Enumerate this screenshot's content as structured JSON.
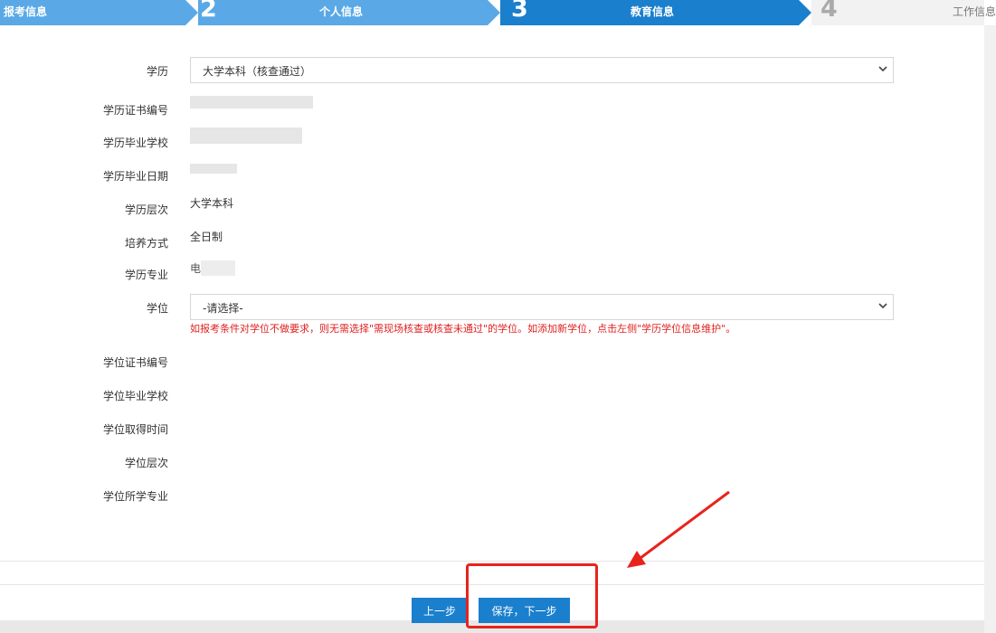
{
  "steps": [
    {
      "num": "",
      "label": "报考信息",
      "active": true
    },
    {
      "num": "2",
      "label": "个人信息",
      "active": true
    },
    {
      "num": "3",
      "label": "教育信息",
      "active": true,
      "current": true
    },
    {
      "num": "4",
      "label": "工作信息",
      "active": false
    }
  ],
  "form": {
    "education_label": "学历",
    "education_value": "大学本科（核查通过）",
    "cert_no_label": "学历证书编号",
    "grad_school_label": "学历毕业学校",
    "grad_date_label": "学历毕业日期",
    "level_label": "学历层次",
    "level_value": "大学本科",
    "study_mode_label": "培养方式",
    "study_mode_value": "全日制",
    "major_label": "学历专业",
    "major_value": "电",
    "degree_label": "学位",
    "degree_placeholder": "-请选择-",
    "degree_hint": "如报考条件对学位不做要求，则无需选择\"需现场核查或核查未通过\"的学位。如添加新学位，点击左侧\"学历学位信息维护\"。",
    "degree_cert_label": "学位证书编号",
    "degree_school_label": "学位毕业学校",
    "degree_time_label": "学位取得时间",
    "degree_level_label": "学位层次",
    "degree_major_label": "学位所学专业"
  },
  "buttons": {
    "prev": "上一步",
    "save_next": "保存，下一步"
  },
  "colors": {
    "primary": "#1a7fcd",
    "step_done": "#5aa9e6",
    "step_current": "#1a7fcd",
    "step_todo": "#f2f2f2",
    "hint": "#e02020",
    "annotation": "#e8231c"
  }
}
